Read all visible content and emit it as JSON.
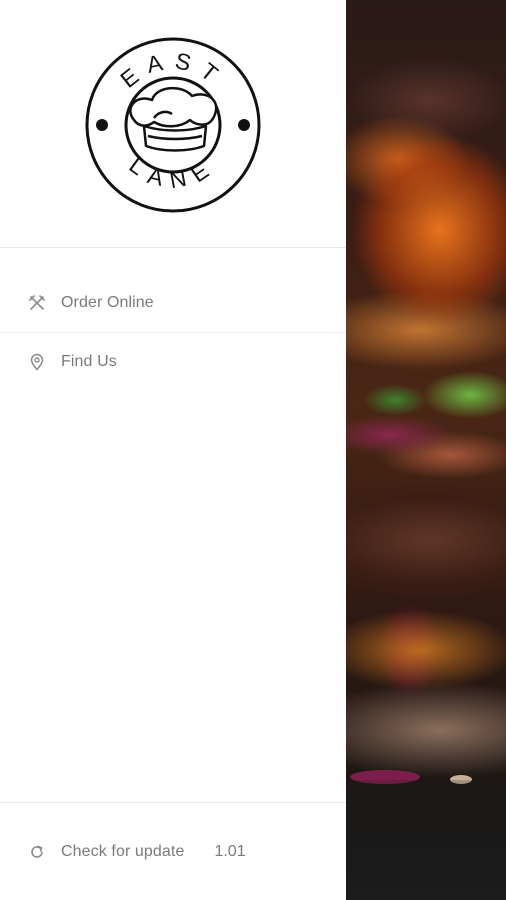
{
  "logo": {
    "top_text": "EAST",
    "bottom_text": "LANE",
    "icon": "chef-hat-icon"
  },
  "menu": {
    "items": [
      {
        "label": "Order Online",
        "icon": "utensils-icon"
      },
      {
        "label": "Find Us",
        "icon": "location-pin-icon"
      }
    ]
  },
  "footer": {
    "update_label": "Check for update",
    "version": "1.01",
    "icon": "refresh-icon"
  },
  "colors": {
    "drawer_bg": "#ffffff",
    "text": "#7a7a7a",
    "divider": "#e6e6e6"
  }
}
